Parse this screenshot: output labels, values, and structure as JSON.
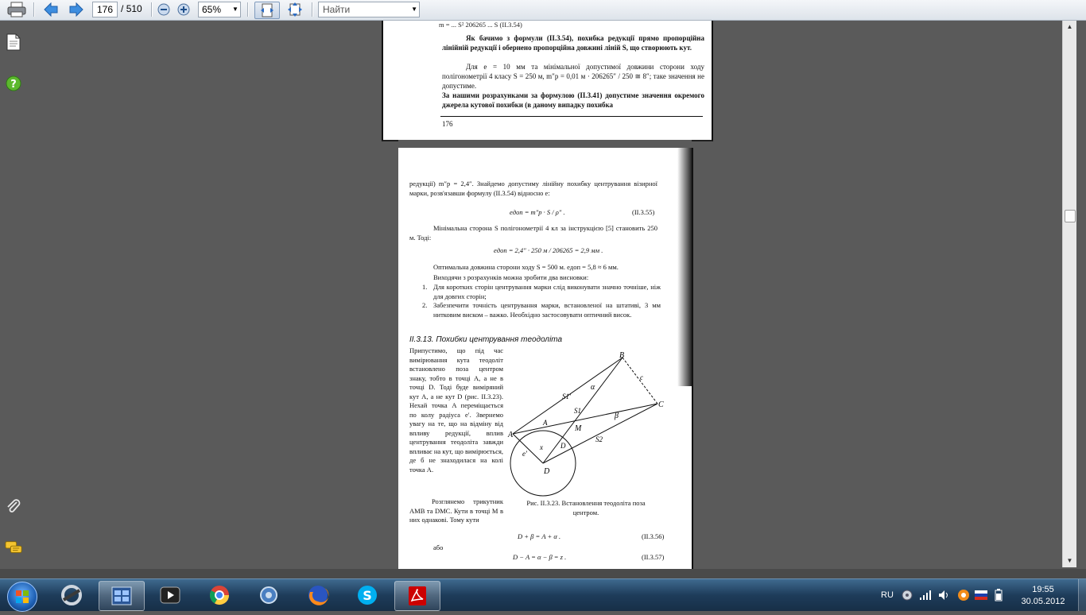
{
  "toolbar": {
    "page_current": "176",
    "page_separator": "/",
    "page_total": "510",
    "zoom": "65%",
    "find_placeholder": "Найти"
  },
  "page_top": {
    "formula_fragment": "m = ... S² 206265 ... S (II.3.54)",
    "para1": "Як бачимо з формули (II.3.54), похибка редукції прямо пропорційна лінійній редукції і обернено пропорційна довжині ліній S, що створюють кут.",
    "para2a": "Для e = 10 мм та мінімальної допустимої довжини сторони ходу полігонометрії 4 класу S = 250 м, m″p = 0,01 м · 206265″ / 250 ≅ 8″; таке значення не допустиме.",
    "para2b": "За нашими розрахунками за формулою (II.3.41) допустиме значення окремого джерела кутової похибки (в даному випадку похибка",
    "page_number": "176"
  },
  "page_bottom": {
    "p1": "редукції) m″p = 2,4″. Знайдемо допустиму лінійну похибку центрування візирної марки, розв'язавши формулу (II.3.54) відносно e:",
    "f1": "eдоп = m″p · S / ρ″ .",
    "f1_num": "(II.3.55)",
    "p2": "Мінімальна сторона S полігонометрії 4 кл за інструкцією [5] становить 250 м. Тоді:",
    "f2": "eдоп = 2,4″ · 250 м / 206265 = 2,9 мм .",
    "p3": "Оптимальна довжина сторони ходу S = 500 м. eдоп = 5,8 ≈ 6 мм.",
    "p4": "Виходячи з розрахунків можна зробити два висновки:",
    "list": [
      {
        "n": "1.",
        "text": "Для коротких сторін центрування марки слід виконувати значно точніше, ніж для довгих сторін;"
      },
      {
        "n": "2.",
        "text": "Забезпечити точність центрування марки, встановленої на штативі, 3 мм нитковим виском – важко. Необхідно застосовувати оптичний висок."
      }
    ],
    "heading": "II.3.13. Похибки центрування теодоліта",
    "left_text": "Припустимо, що під час вимірювання кута теодоліт встановлено поза центром знаку, тобто в точці A, а не в точці D. Тоді буде виміряний кут A, а не кут D (рис. II.3.23). Нехай точка A переміщається по колу радіуса e′. Звернемо увагу на те, що на відміну від впливу редукції, вплив центрування теодоліта завжди впливає на кут, що вимірюється, де б не знаходилася на колі точка A.",
    "left_text2": "Розглянемо трикутник AMB та DMC. Кути в точці M в них однакові. Тому кути",
    "caption": "Рис. II.3.23. Встановлення теодоліта поза центром.",
    "eq1": "D + β = A + α .",
    "eq1_num": "(II.3.56)",
    "or": "або",
    "eq2": "D − A = α − β = z .",
    "eq2_num": "(II.3.57)",
    "fig_labels": {
      "B": "B",
      "C": "C",
      "A": "A",
      "D": "D",
      "M": "M",
      "c": "c",
      "S1p": "S1′",
      "S1": "S1",
      "S2": "S2",
      "alpha": "α",
      "beta": "β",
      "x": "x",
      "e": "e′",
      "Aang": "A",
      "Dang": "D"
    }
  },
  "taskbar": {
    "lang": "RU",
    "time": "19:55",
    "date": "30.05.2012"
  }
}
